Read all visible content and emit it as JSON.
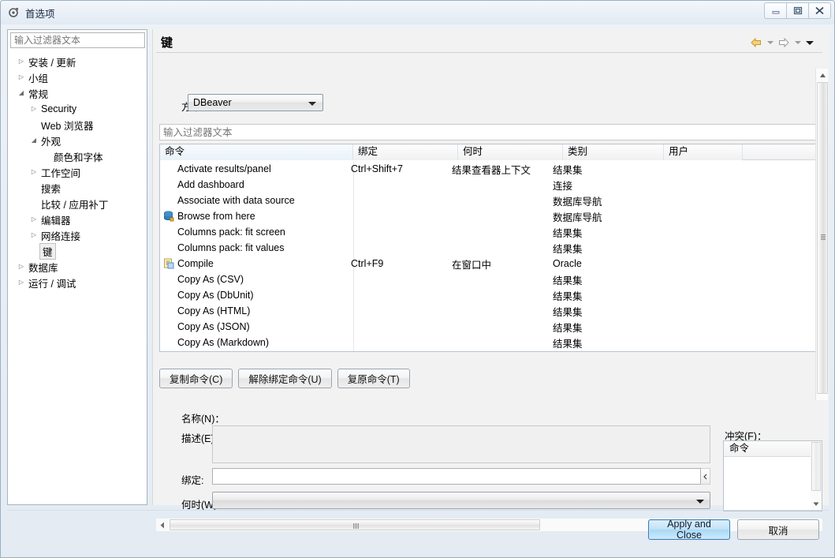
{
  "window": {
    "title": "首选项",
    "icon": "preferences-icon",
    "controls": {
      "minimize": "minimize-icon",
      "maximize": "maximize-icon",
      "close": "close-icon"
    }
  },
  "sidebar": {
    "filter_placeholder": "输入过滤器文本",
    "items": [
      {
        "label": "安装 / 更新",
        "depth": 0,
        "twisty": "collapsed",
        "selected": false
      },
      {
        "label": "小组",
        "depth": 0,
        "twisty": "collapsed",
        "selected": false
      },
      {
        "label": "常规",
        "depth": 0,
        "twisty": "expanded",
        "selected": false
      },
      {
        "label": "Security",
        "depth": 1,
        "twisty": "collapsed",
        "selected": false
      },
      {
        "label": "Web 浏览器",
        "depth": 1,
        "twisty": "none",
        "selected": false
      },
      {
        "label": "外观",
        "depth": 1,
        "twisty": "expanded",
        "selected": false
      },
      {
        "label": "颜色和字体",
        "depth": 2,
        "twisty": "none",
        "selected": false
      },
      {
        "label": "工作空间",
        "depth": 1,
        "twisty": "collapsed",
        "selected": false
      },
      {
        "label": "搜索",
        "depth": 1,
        "twisty": "none",
        "selected": false
      },
      {
        "label": "比较 / 应用补丁",
        "depth": 1,
        "twisty": "none",
        "selected": false
      },
      {
        "label": "编辑器",
        "depth": 1,
        "twisty": "collapsed",
        "selected": false
      },
      {
        "label": "网络连接",
        "depth": 1,
        "twisty": "collapsed",
        "selected": false
      },
      {
        "label": "键",
        "depth": 1,
        "twisty": "none",
        "selected": true
      },
      {
        "label": "数据库",
        "depth": 0,
        "twisty": "collapsed",
        "selected": false
      },
      {
        "label": "运行 / 调试",
        "depth": 0,
        "twisty": "collapsed",
        "selected": false
      }
    ]
  },
  "page": {
    "title": "键",
    "nav": {
      "back": "back-arrow-icon",
      "back_menu": "chevron-down-icon",
      "forward": "forward-arrow-icon",
      "forward_menu": "chevron-down-icon",
      "view_menu": "chevron-down-icon"
    },
    "scheme": {
      "label": "方案:",
      "value": "DBeaver"
    },
    "table_filter_placeholder": "输入过滤器文本"
  },
  "table": {
    "columns": [
      "命令",
      "绑定",
      "何时",
      "类别",
      "用户"
    ],
    "sorted_column": "命令",
    "sort_direction": "ascending",
    "rows": [
      {
        "icon": "",
        "command": "Activate results/panel",
        "binding": "Ctrl+Shift+7",
        "when": "结果查看器上下文",
        "category": "结果集",
        "user": ""
      },
      {
        "icon": "",
        "command": "Add dashboard",
        "binding": "",
        "when": "",
        "category": "连接",
        "user": ""
      },
      {
        "icon": "",
        "command": "Associate with data source",
        "binding": "",
        "when": "",
        "category": "数据库导航",
        "user": ""
      },
      {
        "icon": "database-icon",
        "command": "Browse from here",
        "binding": "",
        "when": "",
        "category": "数据库导航",
        "user": ""
      },
      {
        "icon": "",
        "command": "Columns pack: fit screen",
        "binding": "",
        "when": "",
        "category": "结果集",
        "user": ""
      },
      {
        "icon": "",
        "command": "Columns pack: fit values",
        "binding": "",
        "when": "",
        "category": "结果集",
        "user": ""
      },
      {
        "icon": "compile-icon",
        "command": "Compile",
        "binding": "Ctrl+F9",
        "when": "在窗口中",
        "category": "Oracle",
        "user": ""
      },
      {
        "icon": "",
        "command": "Copy As (CSV)",
        "binding": "",
        "when": "",
        "category": "结果集",
        "user": ""
      },
      {
        "icon": "",
        "command": "Copy As (DbUnit)",
        "binding": "",
        "when": "",
        "category": "结果集",
        "user": ""
      },
      {
        "icon": "",
        "command": "Copy As (HTML)",
        "binding": "",
        "when": "",
        "category": "结果集",
        "user": ""
      },
      {
        "icon": "",
        "command": "Copy As (JSON)",
        "binding": "",
        "when": "",
        "category": "结果集",
        "user": ""
      },
      {
        "icon": "",
        "command": "Copy As (Markdown)",
        "binding": "",
        "when": "",
        "category": "结果集",
        "user": ""
      }
    ]
  },
  "actions": {
    "copy_command": "复制命令(C)",
    "unbind_command": "解除绑定命令(U)",
    "restore_command": "复原命令(T)"
  },
  "details": {
    "name_label": "名称(N)：",
    "name_value": "",
    "description_label": "描述(E)：",
    "description_value": "",
    "binding_label": "绑定:",
    "binding_value": "",
    "when_label": "何时(W)：",
    "when_value": ""
  },
  "conflicts": {
    "label": "冲突(F)：",
    "column": "命令",
    "rows": []
  },
  "footer": {
    "apply": "Apply and Close",
    "cancel": "取消"
  },
  "colors": {
    "accent": "#3c7fb1",
    "window_border": "#9ab0c4",
    "back_arrow": "#f0c44a"
  }
}
